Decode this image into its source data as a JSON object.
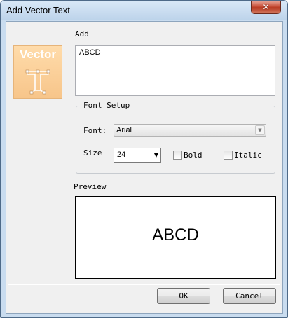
{
  "window": {
    "title": "Add Vector Text",
    "close_glyph": "✕"
  },
  "logo": {
    "word": "Vector",
    "icon": "vector-text-T-icon"
  },
  "add_section": {
    "label": "Add",
    "text_value": "ABCD"
  },
  "font_setup": {
    "legend": "Font Setup",
    "font_label": "Font:",
    "font_value": "Arial",
    "size_label": "Size",
    "size_value": "24",
    "bold_label": "Bold",
    "bold_checked": false,
    "italic_label": "Italic",
    "italic_checked": false
  },
  "preview": {
    "label": "Preview",
    "text": "ABCD"
  },
  "buttons": {
    "ok": "OK",
    "cancel": "Cancel"
  },
  "colors": {
    "frame": "#c9dcef",
    "close_red": "#c8503a",
    "logo_orange": "#f7c58a"
  }
}
